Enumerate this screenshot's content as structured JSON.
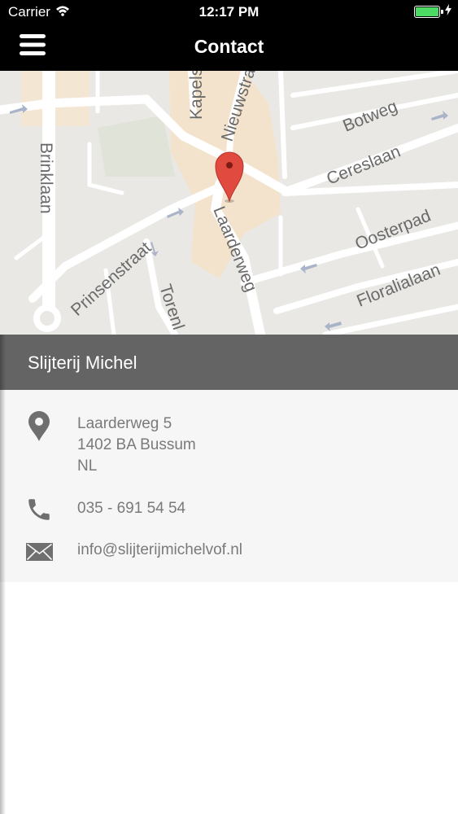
{
  "status_bar": {
    "carrier": "Carrier",
    "time": "12:17 PM"
  },
  "nav": {
    "title": "Contact"
  },
  "map": {
    "streets": [
      "Kapels",
      "Nieuwstra",
      "Botweg",
      "Brinklaan",
      "Cereslaan",
      "Laarderweg",
      "Oosterpad",
      "Prinsenstraat",
      "Floralialaan",
      "Torenl"
    ]
  },
  "business": {
    "name": "Slijterij Michel"
  },
  "contact": {
    "address_line1": "Laarderweg 5",
    "address_line2": "1402 BA Bussum",
    "address_line3": "NL",
    "phone": "035 - 691 54 54",
    "email": "info@slijterijmichelvof.nl"
  },
  "colors": {
    "nav_bg": "#000000",
    "header_bg": "#646464",
    "icon": "#6f6f6f",
    "text": "#7a7a7a",
    "pin": "#e04a3f"
  }
}
